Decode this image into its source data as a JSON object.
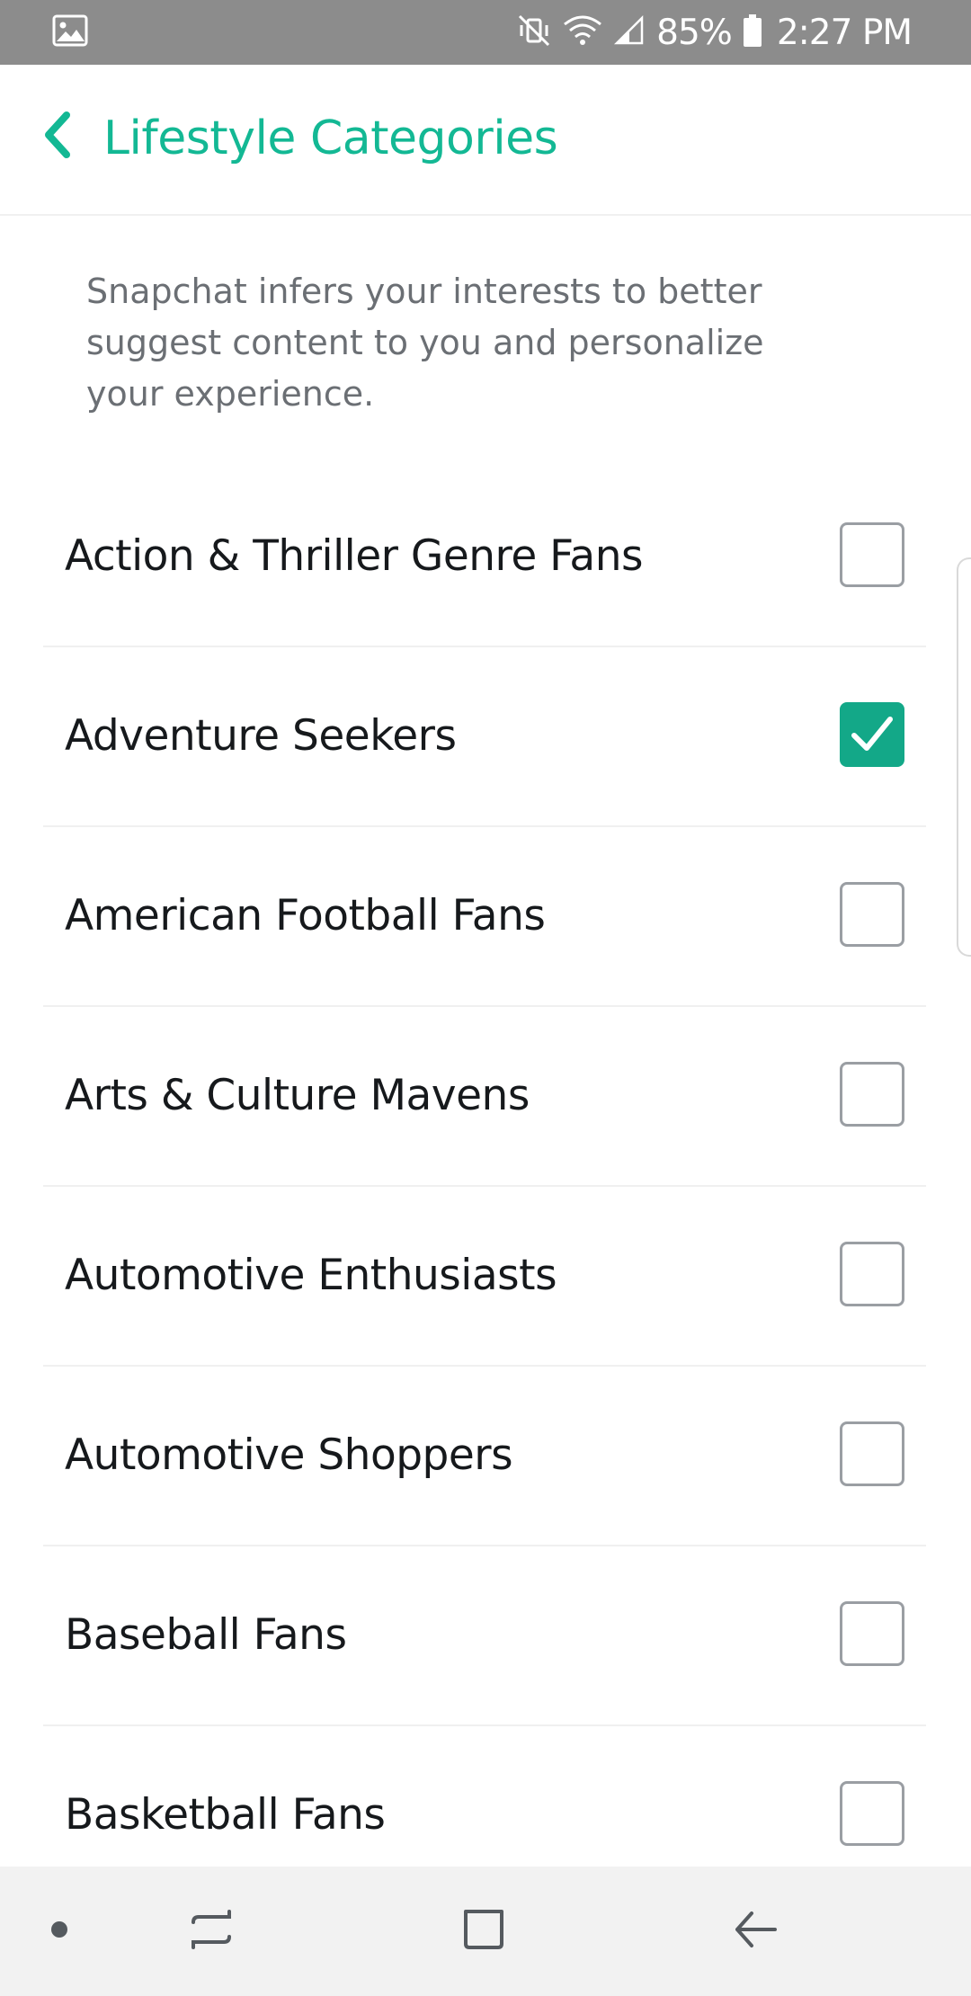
{
  "status_bar": {
    "battery_percent": "85%",
    "time": "2:27 PM",
    "icons": [
      "gallery-icon",
      "mute-vibrate-icon",
      "wifi-icon",
      "signal-icon",
      "battery-icon"
    ]
  },
  "header": {
    "title": "Lifestyle Categories",
    "back_icon": "chevron-left-icon"
  },
  "description": "Snapchat infers your interests to better suggest content to you and personalize your experience.",
  "categories": [
    {
      "label": "Action & Thriller Genre Fans",
      "checked": false
    },
    {
      "label": "Adventure Seekers",
      "checked": true
    },
    {
      "label": "American Football Fans",
      "checked": false
    },
    {
      "label": "Arts & Culture Mavens",
      "checked": false
    },
    {
      "label": "Automotive Enthusiasts",
      "checked": false
    },
    {
      "label": "Automotive Shoppers",
      "checked": false
    },
    {
      "label": "Baseball Fans",
      "checked": false
    },
    {
      "label": "Basketball Fans",
      "checked": false
    }
  ],
  "nav_bar": {
    "icons": [
      "nav-dot-icon",
      "recents-icon",
      "home-icon",
      "back-arrow-icon"
    ]
  },
  "colors": {
    "accent": "#13b894",
    "checkbox_checked": "#13a888",
    "status_bar": "#8c8c8c"
  }
}
